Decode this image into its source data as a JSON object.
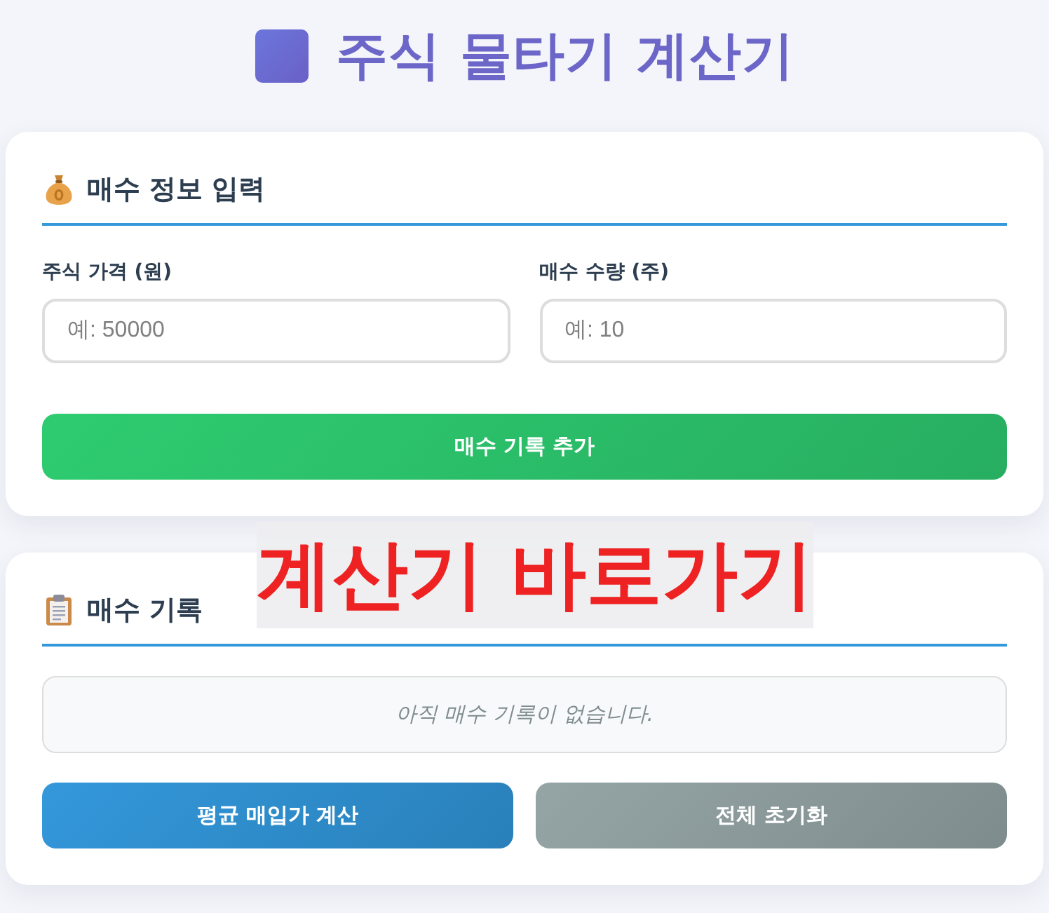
{
  "title": {
    "text": "주식 물타기 계산기"
  },
  "purchase_form": {
    "heading": "매수 정보 입력",
    "fields": [
      {
        "label": "주식 가격 (원)",
        "placeholder": "예: 50000"
      },
      {
        "label": "매수 수량 (주)",
        "placeholder": "예: 10"
      }
    ],
    "add_button": "매수 기록 추가"
  },
  "overlay_link": {
    "label": "계산기 바로가기"
  },
  "purchase_history": {
    "heading": "매수 기록",
    "empty_message": "아직 매수 기록이 없습니다.",
    "buttons": [
      {
        "label": "평균 매입가 계산",
        "kind": "primary"
      },
      {
        "label": "전체 초기화",
        "kind": "secondary"
      }
    ]
  }
}
